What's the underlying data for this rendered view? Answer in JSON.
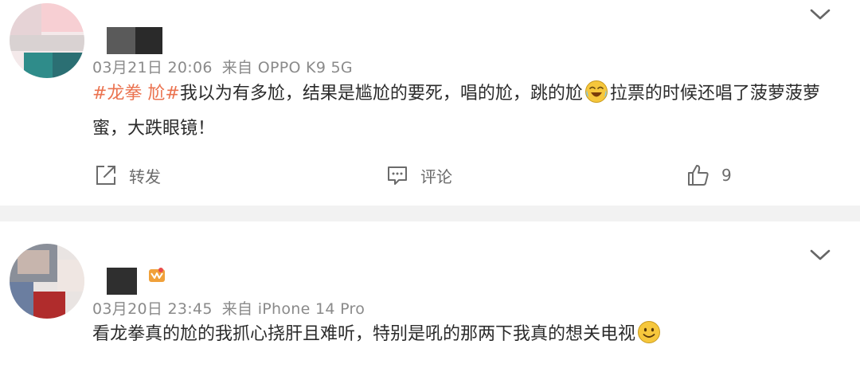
{
  "posts": [
    {
      "timestamp": "03月21日 20:06",
      "source": "来自 OPPO K9 5G",
      "content": {
        "topic": "#龙拳 尬#",
        "text1": "我以为有多尬，结果是尴尬的要死，唱的尬，跳的尬",
        "emoji": "laughing-crying-emoji",
        "text2": "拉票的时候还唱了菠萝菠萝蜜，大跌眼镜！"
      },
      "actions": {
        "repost_label": "转发",
        "comment_label": "评论",
        "like_count": "9"
      }
    },
    {
      "timestamp": "03月20日 23:45",
      "source": "来自 iPhone 14 Pro",
      "content": {
        "text": "看龙拳真的尬的我抓心挠肝且难听，特别是吼的那两下我真的想关电视",
        "emoji": "smile-emoji"
      },
      "badge_icon": "vip-badge-icon"
    }
  ],
  "colors": {
    "topic": "#eb7350",
    "meta": "#8a8a8a",
    "divider": "#f2f2f2"
  }
}
